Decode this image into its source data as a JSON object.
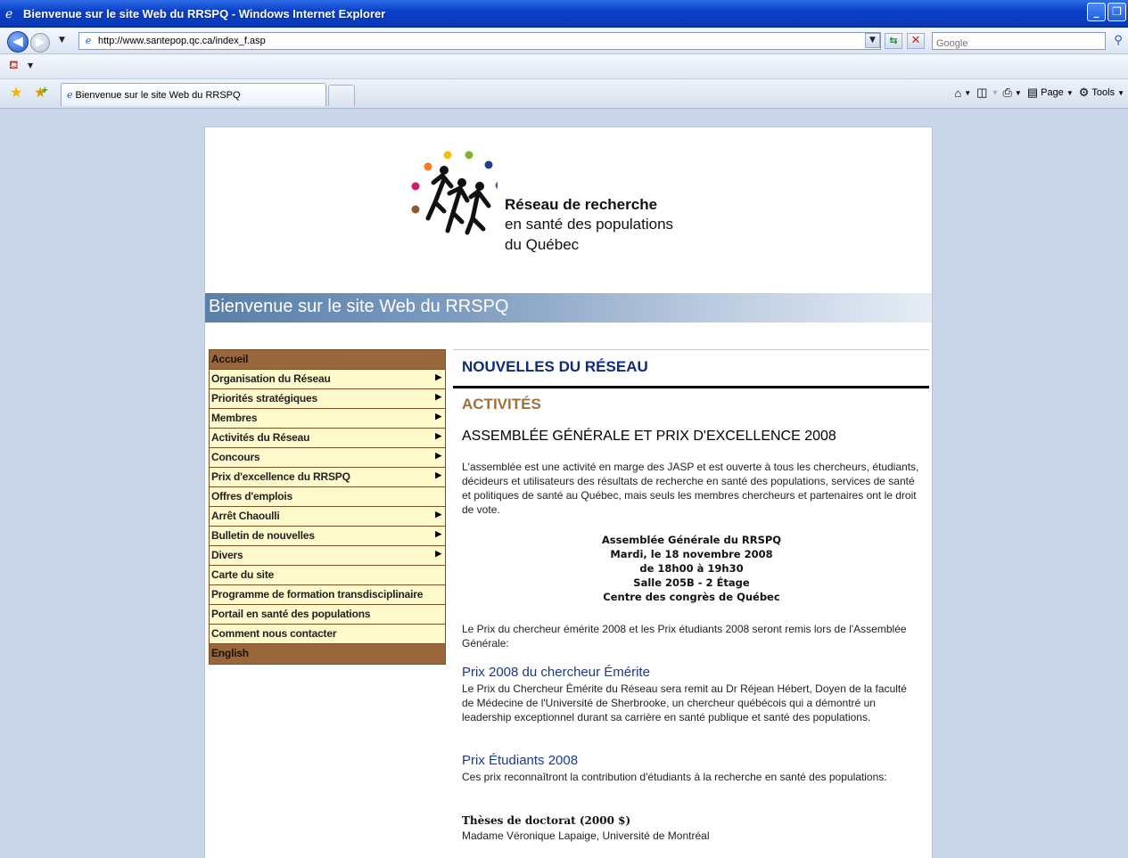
{
  "window": {
    "title": "Bienvenue sur le site Web du RRSPQ - Windows Internet Explorer"
  },
  "addressbar": {
    "url": "http://www.santepop.qc.ca/index_f.asp",
    "search_placeholder": "Google"
  },
  "tabs": {
    "active_label": "Bienvenue sur le site Web du RRSPQ"
  },
  "commandbar": {
    "page_label": "Page",
    "tools_label": "Tools"
  },
  "logo": {
    "title": "Réseau de recherche",
    "line2": "en santé des populations",
    "line3": "du Québec",
    "dot_colors": [
      "#f47c20",
      "#f2c200",
      "#7ab829",
      "#1f3d8c",
      "#8e3fa0",
      "#d3186f",
      "#8b5a2b"
    ]
  },
  "banner": {
    "text": "Bienvenue sur le site Web du RRSPQ"
  },
  "nav": {
    "items": [
      {
        "label": "Accueil",
        "arrow": false,
        "style": "brown"
      },
      {
        "label": "Organisation du Réseau",
        "arrow": true,
        "style": "normal"
      },
      {
        "label": "Priorités stratégiques",
        "arrow": true,
        "style": "normal"
      },
      {
        "label": "Membres",
        "arrow": true,
        "style": "normal"
      },
      {
        "label": "Activités du Réseau",
        "arrow": true,
        "style": "normal"
      },
      {
        "label": "Concours",
        "arrow": true,
        "style": "normal"
      },
      {
        "label": "Prix d'excellence du RRSPQ",
        "arrow": true,
        "style": "normal"
      },
      {
        "label": "Offres d'emplois",
        "arrow": false,
        "style": "normal"
      },
      {
        "label": "Arrêt Chaoulli",
        "arrow": true,
        "style": "normal"
      },
      {
        "label": "Bulletin de nouvelles",
        "arrow": true,
        "style": "normal"
      },
      {
        "label": "Divers",
        "arrow": true,
        "style": "normal"
      },
      {
        "label": "Carte du site",
        "arrow": false,
        "style": "normal"
      },
      {
        "label": "Programme de formation transdisciplinaire",
        "arrow": false,
        "style": "normal"
      },
      {
        "label": "Portail en santé des populations",
        "arrow": false,
        "style": "normal"
      },
      {
        "label": "Comment nous contacter",
        "arrow": false,
        "style": "normal"
      },
      {
        "label": "English",
        "arrow": false,
        "style": "brown"
      }
    ]
  },
  "main": {
    "news_title": "NOUVELLES DU RÉSEAU",
    "activities_title": "ACTIVITÉS",
    "section_title": "ASSEMBLÉE GÉNÉRALE ET PRIX D'EXCELLENCE 2008",
    "para1": "L'assemblée est une activité en marge des JASP et est ouverte à tous les chercheurs, étudiants, décideurs et utilisateurs des résultats de recherche en santé des populations, services de santé et politiques de santé au Québec, mais seuls les membres chercheurs et partenaires ont le droit de vote.",
    "assembly": {
      "line1": "Assemblée Générale du RRSPQ",
      "line2": "Mardi, le 18 novembre 2008",
      "line3": "de 18h00 à 19h30",
      "line4": "Salle 205B - 2 Étage",
      "line5": "Centre des congrès de Québec"
    },
    "para2": "Le Prix du chercheur émérite 2008 et les Prix étudiants 2008 seront remis lors de l'Assemblée Générale:",
    "prize1_title": "Prix 2008 du chercheur Émérite",
    "prize1_text": "Le Prix du Chercheur Émérite du Réseau sera remit au Dr Réjean Hébert, Doyen de la faculté de Médecine de l'Université de Sherbrooke, un chercheur québécois qui a démontré un leadership exceptionnel durant sa carrière en santé publique et santé des populations.",
    "prize2_title": "Prix Étudiants 2008",
    "prize2_text": "Ces prix reconnaîtront la contribution d'étudiants à la recherche en santé des populations:",
    "thesis_title": "Thèses de doctorat (2000 $)",
    "thesis_winner": "Madame Véronique Lapaige, Université de Montréal"
  }
}
